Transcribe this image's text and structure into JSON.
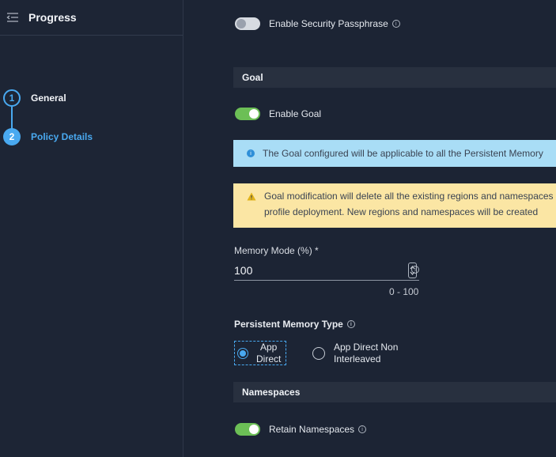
{
  "sidebar": {
    "title": "Progress",
    "steps": [
      {
        "number": "1",
        "label": "General"
      },
      {
        "number": "2",
        "label": "Policy Details"
      }
    ]
  },
  "security": {
    "passphrase_label": "Enable Security Passphrase",
    "passphrase_enabled": false
  },
  "goal": {
    "section_title": "Goal",
    "enable_label": "Enable Goal",
    "enabled": true,
    "info_banner": "The Goal configured will be applicable to all the Persistent Memory",
    "warning_line1": "Goal modification will delete all the existing regions and namespaces",
    "warning_line2": "profile deployment. New regions and namespaces will be created"
  },
  "memory_mode": {
    "label": "Memory Mode (%) *",
    "value": "100",
    "hint": "0 - 100"
  },
  "persistent_memory_type": {
    "label": "Persistent Memory Type",
    "options": [
      {
        "line1": "App",
        "line2": "Direct",
        "selected": true
      },
      {
        "line1": "App Direct Non",
        "line2": "Interleaved",
        "selected": false
      }
    ]
  },
  "namespaces": {
    "section_title": "Namespaces",
    "retain_label": "Retain Namespaces",
    "retain_enabled": true
  },
  "colors": {
    "accent": "#49a9f0",
    "toggle_on": "#6cbf56",
    "info_bg": "#a9ddf6",
    "warning_bg": "#fbe6a4"
  },
  "icons": [
    "menu-collapse-icon",
    "info-icon",
    "warning-icon",
    "spinner-icon"
  ]
}
